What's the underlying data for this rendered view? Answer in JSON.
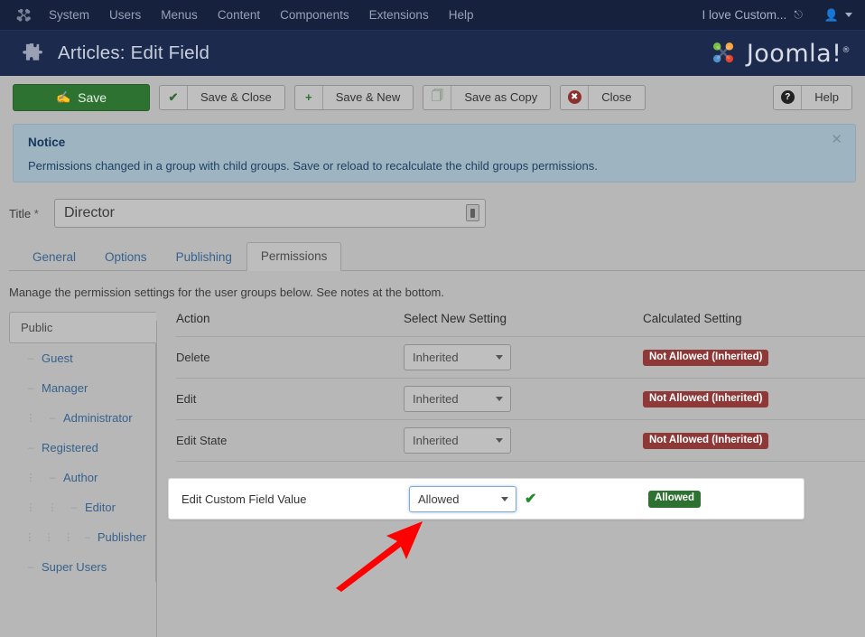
{
  "topbar": {
    "logo_icon": "joomla-logo-icon",
    "menu": [
      {
        "label": "System"
      },
      {
        "label": "Users"
      },
      {
        "label": "Menus"
      },
      {
        "label": "Content"
      },
      {
        "label": "Components"
      },
      {
        "label": "Extensions"
      },
      {
        "label": "Help"
      }
    ],
    "site_link": "I love Custom...",
    "site_link_icon": "external-link-icon",
    "user_icon": "user-icon",
    "user_caret_icon": "chevron-down-icon"
  },
  "header": {
    "icon": "puzzle-piece-icon",
    "title": "Articles: Edit Field",
    "brand": "Joomla!",
    "brand_reg": "®"
  },
  "toolbar": {
    "save": {
      "label": "Save",
      "icon": "pencil-square-icon"
    },
    "save_close": {
      "label": "Save & Close",
      "icon": "check-icon"
    },
    "save_new": {
      "label": "Save & New",
      "icon": "plus-icon"
    },
    "save_copy": {
      "label": "Save as Copy",
      "icon": "copy-icon"
    },
    "close": {
      "label": "Close",
      "icon": "circle-x-icon"
    },
    "help": {
      "label": "Help",
      "icon": "circle-question-icon"
    }
  },
  "notice": {
    "title": "Notice",
    "message": "Permissions changed in a group with child groups. Save or reload to recalculate the child groups permissions.",
    "close_icon": "close-icon"
  },
  "title_field": {
    "label": "Title",
    "required_mark": "*",
    "value": "Director",
    "placeholder": "",
    "inline_icon": "form-autofill-icon"
  },
  "tabs": [
    {
      "label": "General",
      "active": false
    },
    {
      "label": "Options",
      "active": false
    },
    {
      "label": "Publishing",
      "active": false
    },
    {
      "label": "Permissions",
      "active": true
    }
  ],
  "description": "Manage the permission settings for the user groups below. See notes at the bottom.",
  "group_tabs": [
    {
      "label": "Public",
      "indent": 0,
      "dash": "",
      "active": true
    },
    {
      "label": "Guest",
      "indent": 0,
      "dash": "–",
      "active": false
    },
    {
      "label": "Manager",
      "indent": 0,
      "dash": "–",
      "active": false
    },
    {
      "label": "Administrator",
      "indent": 1,
      "dash": "–",
      "active": false
    },
    {
      "label": "Registered",
      "indent": 0,
      "dash": "–",
      "active": false
    },
    {
      "label": "Author",
      "indent": 1,
      "dash": "–",
      "active": false
    },
    {
      "label": "Editor",
      "indent": 2,
      "dash": "–",
      "active": false
    },
    {
      "label": "Publisher",
      "indent": 3,
      "dash": "–",
      "active": false
    },
    {
      "label": "Super Users",
      "indent": 0,
      "dash": "–",
      "active": false
    }
  ],
  "permissions_table": {
    "headers": {
      "action": "Action",
      "select": "Select New Setting",
      "calculated": "Calculated Setting"
    },
    "rows": [
      {
        "action": "Delete",
        "setting": "Inherited",
        "calculated": "Not Allowed (Inherited)",
        "status": "danger",
        "focused": false,
        "checked": false
      },
      {
        "action": "Edit",
        "setting": "Inherited",
        "calculated": "Not Allowed (Inherited)",
        "status": "danger",
        "focused": false,
        "checked": false
      },
      {
        "action": "Edit State",
        "setting": "Inherited",
        "calculated": "Not Allowed (Inherited)",
        "status": "danger",
        "focused": false,
        "checked": false
      }
    ],
    "highlighted_row": {
      "action": "Edit Custom Field Value",
      "setting": "Allowed",
      "calculated": "Allowed",
      "status": "success",
      "focused": true,
      "check_icon": "check-icon"
    }
  },
  "annotation": {
    "arrow_color": "#fe0000",
    "arrow_icon": "pointer-arrow-icon"
  },
  "colors": {
    "brand_dark": "#16213e",
    "header_dark": "#1c2a4d",
    "page_bg": "#b7b7b7",
    "success": "#2d7230",
    "danger": "#8e3838",
    "link": "#37618c"
  }
}
